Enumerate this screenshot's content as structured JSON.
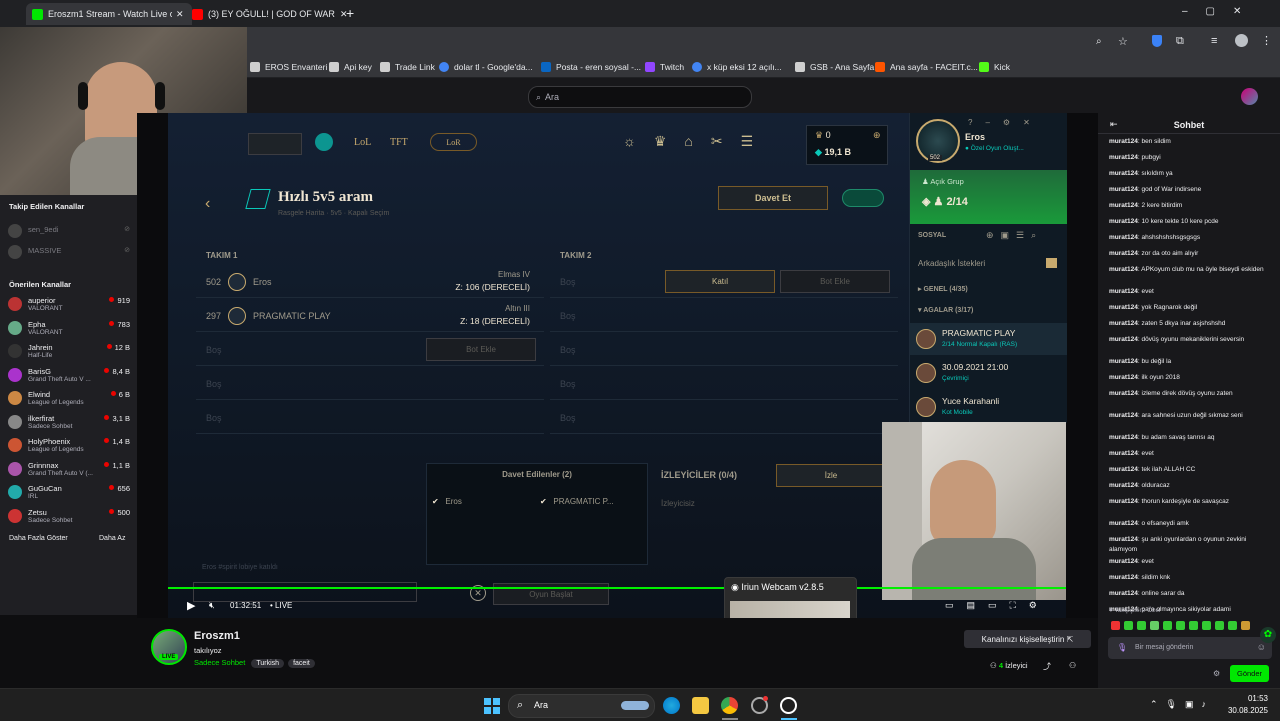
{
  "browser": {
    "tabs": [
      {
        "title": "Eroszm1 Stream - Watch Live o",
        "active": true,
        "favicon_color": "#00e701"
      },
      {
        "title": "(3) EY OĞULL! | GOD OF WAR | B",
        "active": false,
        "favicon_color": "#ff0000"
      }
    ],
    "new_tab": "+",
    "bookmarks": [
      {
        "label": "EROS Envanteri",
        "color": "#cfcfcf"
      },
      {
        "label": "Api key",
        "color": "#cfcfcf"
      },
      {
        "label": "Trade Link",
        "color": "#cfcfcf"
      },
      {
        "label": "dolar tl - Google'da...",
        "color": "#4285f4"
      },
      {
        "label": "Posta - eren soysal -...",
        "color": "#0a66c2"
      },
      {
        "label": "Twitch",
        "color": "#9146ff"
      },
      {
        "label": "x küp eksi 12 açılı...",
        "color": "#4285f4"
      },
      {
        "label": "GSB - Ana Sayfa",
        "color": "#cfcfcf"
      },
      {
        "label": "Ana sayfa - FACEIT.c...",
        "color": "#ff5500"
      },
      {
        "label": "Kick",
        "color": "#53fc18"
      }
    ]
  },
  "twitch": {
    "search_placeholder": "Ara",
    "sidebar": {
      "followed_title": "Takip Edilen Kanallar",
      "followed": [
        {
          "name": "sen_9edi"
        },
        {
          "name": "MASSIVE"
        }
      ],
      "recommended_title": "Önerilen Kanallar",
      "recommended": [
        {
          "name": "auperior",
          "game": "VALORANT",
          "viewers": "919",
          "color": "#b33"
        },
        {
          "name": "Epha",
          "game": "VALORANT",
          "viewers": "783",
          "color": "#6a8"
        },
        {
          "name": "Jahrein",
          "game": "Half-Life",
          "viewers": "12 B",
          "color": "#333"
        },
        {
          "name": "BarisG",
          "game": "Grand Theft Auto V ...",
          "viewers": "8,4 B",
          "color": "#a3c"
        },
        {
          "name": "Elwind",
          "game": "League of Legends",
          "viewers": "6 B",
          "color": "#c84"
        },
        {
          "name": "ilkerfirat",
          "game": "Sadece Sohbet",
          "viewers": "3,1 B",
          "color": "#888"
        },
        {
          "name": "HolyPhoenix",
          "game": "League of Legends",
          "viewers": "1,4 B",
          "color": "#c53"
        },
        {
          "name": "Grinnnax",
          "game": "Grand Theft Auto V (...",
          "viewers": "1,1 B",
          "color": "#a5a"
        },
        {
          "name": "GuGuCan",
          "game": "IRL",
          "viewers": "656",
          "color": "#2aa"
        },
        {
          "name": "Zetsu",
          "game": "Sadece Sohbet",
          "viewers": "500",
          "color": "#c33"
        }
      ],
      "show_more": "Daha Fazla Göster",
      "show_less": "Daha Az"
    },
    "player": {
      "time": "01:32:51",
      "live": "LIVE",
      "progress": 1.0
    },
    "channel": {
      "name": "Eroszm1",
      "title": "takılıyoz",
      "category": "Sadece Sohbet",
      "tags": [
        "Turkish",
        "faceit"
      ],
      "live_badge": "LIVE",
      "customize_button": "Kanalınızı kişiselleştirin",
      "viewers": "4",
      "viewers_label": "İzleyici"
    },
    "chat": {
      "title": "Sohbet",
      "messages": [
        {
          "user": "murat124",
          "text": "ben sildim"
        },
        {
          "user": "murat124",
          "text": "pubgyi"
        },
        {
          "user": "murat124",
          "text": "sıkıldım ya"
        },
        {
          "user": "murat124",
          "text": "god of War indirsene"
        },
        {
          "user": "murat124",
          "text": "2 kere bitirdim"
        },
        {
          "user": "murat124",
          "text": "10 kere tekte 10 kere pcde"
        },
        {
          "user": "murat124",
          "text": "ahshshshshsgsgsgs"
        },
        {
          "user": "murat124",
          "text": "zor da oto aim alıyir"
        },
        {
          "user": "murat124",
          "text": "APKoyum club mu na öyle biseydi eskiden"
        },
        {
          "user": "murat124",
          "text": "evet"
        },
        {
          "user": "murat124",
          "text": "yok Ragnarok değil"
        },
        {
          "user": "murat124",
          "text": "zaten 5 dkya inar asjshshshd"
        },
        {
          "user": "murat124",
          "text": "dövüş oyunu mekaniklerini seversin"
        },
        {
          "user": "murat124",
          "text": "bu değil la"
        },
        {
          "user": "murat124",
          "text": "ilk oyun 2018"
        },
        {
          "user": "murat124",
          "text": "izleme direk dövüş oyunu zaten"
        },
        {
          "user": "murat124",
          "text": "ara sahnesi uzun değil sıkmaz seni"
        },
        {
          "user": "murat124",
          "text": "bu adam savaş tanrısı aq"
        },
        {
          "user": "murat124",
          "text": "evet"
        },
        {
          "user": "murat124",
          "text": "tek ilah ALLAH CC"
        },
        {
          "user": "murat124",
          "text": "olduracaz"
        },
        {
          "user": "murat124",
          "text": "thorun kardeşiyle de savaşcaz"
        },
        {
          "user": "murat124",
          "text": "o efsaneydi amk"
        },
        {
          "user": "murat124",
          "text": "şu anki oyunlardan o oyunun zevkini alamıyom"
        },
        {
          "user": "murat124",
          "text": "evet"
        },
        {
          "user": "murat124",
          "text": "sildim knk"
        },
        {
          "user": "murat124",
          "text": "online sarar da"
        },
        {
          "user": "murat124",
          "text": "para olmayınca sikiyolar adami"
        }
      ],
      "followers_only": "Takipçilere Özel",
      "input_placeholder": "Bir mesaj gönderin",
      "send_button": "Gönder"
    }
  },
  "game": {
    "nav": {
      "lol": "LoL",
      "tft": "TFT",
      "lor": "LoR"
    },
    "currency": {
      "blue_essence": "0",
      "orange": "19,1 B"
    },
    "lobby_title": "Hızlı 5v5 aram",
    "lobby_subtitle": "Rasgele Harita   ·   5v5   ·   Kapalı Seçim",
    "invite_button": "Davet Et",
    "team1_label": "TAKIM 1",
    "team2_label": "TAKIM 2",
    "team1": [
      {
        "level": "502",
        "name": "Eros",
        "rank": "Elmas IV",
        "sub": "Z: 106 (DERECELİ)"
      },
      {
        "level": "297",
        "name": "PRAGMATIC PLAY",
        "rank": "Altın III",
        "sub": "Z: 18 (DERECELİ)"
      },
      {
        "level": "",
        "name": "Boş",
        "rank": "",
        "sub": ""
      },
      {
        "level": "",
        "name": "Boş",
        "rank": "",
        "sub": ""
      },
      {
        "level": "",
        "name": "Boş",
        "rank": "",
        "sub": ""
      }
    ],
    "team2": [
      "Boş",
      "Boş",
      "Boş",
      "Boş",
      "Boş"
    ],
    "join_button": "Katıl",
    "bot_button": "Bot Ekle",
    "invited_title": "Davet Edilenler (2)",
    "invited": [
      "Eros",
      "PRAGMATIC P..."
    ],
    "spectators_title": "İZLEYİCİLER (0/4)",
    "spectators_empty": "İzleyicisiz",
    "spectate_button": "İzle",
    "lobby_chat": "Eros #spirit lobiye katıldı",
    "find_match": "Oyun Başlat",
    "social": {
      "name": "Eros",
      "status": "Özel Oyun Oluşt...",
      "level": "502",
      "open_party": "Açık Grup",
      "party_count": "2/14",
      "social_label": "SOSYAL",
      "friend_requests": "Arkadaşlık İstekleri",
      "general": "GENEL (4/35)",
      "groups": "AGALAR (3/17)",
      "friends": [
        {
          "name": "PRAGMATIC PLAY",
          "status": "2/14 Normal Kapalı (RAS)"
        },
        {
          "name": "30.09.2021 21:00",
          "status": "Çevrimiçi"
        },
        {
          "name": "Yuce Karahanli",
          "status": "Kot Mobile"
        }
      ]
    }
  },
  "webcam_preview": {
    "title": "Iriun Webcam v2.8.5"
  },
  "taskbar": {
    "search": "Ara",
    "time": "01:53",
    "date": "30.08.2025"
  }
}
